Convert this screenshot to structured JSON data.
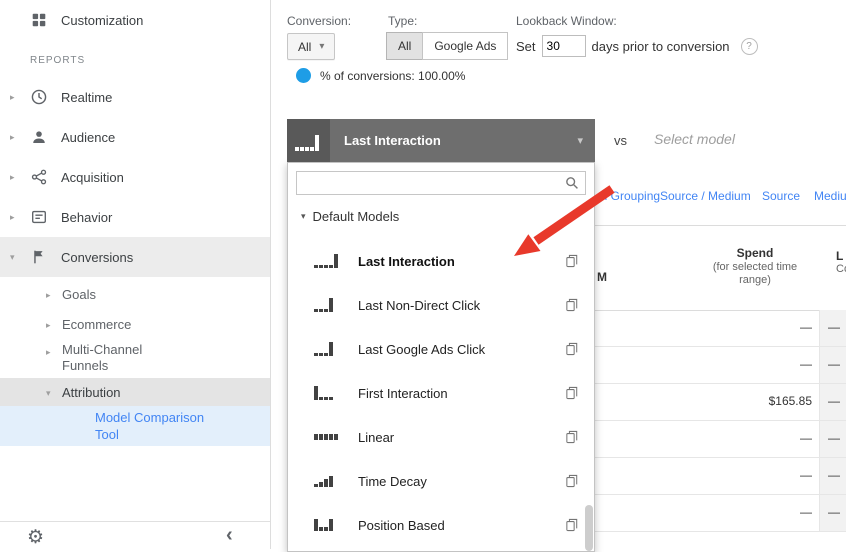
{
  "colors": {
    "accent": "#4285f4",
    "arrow": "#e8392b",
    "dot": "#1e9de6"
  },
  "sidebar": {
    "customization_label": "Customization",
    "reports_label": "REPORTS",
    "nav_items": [
      {
        "label": "Realtime",
        "icon": "clock-icon"
      },
      {
        "label": "Audience",
        "icon": "person-icon"
      },
      {
        "label": "Acquisition",
        "icon": "share-icon"
      },
      {
        "label": "Behavior",
        "icon": "page-icon"
      },
      {
        "label": "Conversions",
        "icon": "flag-icon"
      }
    ],
    "conversions_children": [
      {
        "label": "Goals"
      },
      {
        "label": "Ecommerce"
      },
      {
        "label": "Multi-Channel Funnels"
      },
      {
        "label": "Attribution"
      }
    ],
    "active_item_label": "Model Comparison Tool"
  },
  "toolbar": {
    "conversion_label": "Conversion:",
    "conversion_value": "All",
    "type_label": "Type:",
    "type_all": "All",
    "type_google_ads": "Google Ads",
    "lookback_label": "Lookback Window:",
    "lookback_prefix": "Set",
    "lookback_days": "30",
    "lookback_suffix": "days prior to conversion",
    "percent_of_conversions": "% of conversions: 100.00%"
  },
  "model_bar": {
    "selected_model": "Last Interaction",
    "vs_label": "vs",
    "compare_placeholder": "Select model"
  },
  "dimension_links": {
    "link1": "el Grouping",
    "link2": "Source / Medium",
    "link3": "Source",
    "link4": "Mediu"
  },
  "dropdown": {
    "section_label": "Default Models",
    "header_bars": [
      4,
      4,
      4,
      4,
      16
    ],
    "models": [
      {
        "name": "Last Interaction",
        "bars": [
          3,
          3,
          3,
          3,
          14
        ]
      },
      {
        "name": "Last Non-Direct Click",
        "bars": [
          3,
          3,
          3,
          14
        ]
      },
      {
        "name": "Last Google Ads Click",
        "bars": [
          3,
          3,
          3,
          14
        ]
      },
      {
        "name": "First Interaction",
        "bars": [
          14,
          3,
          3,
          3
        ]
      },
      {
        "name": "Linear",
        "bars": [
          6,
          6,
          6,
          6,
          6
        ]
      },
      {
        "name": "Time Decay",
        "bars": [
          3,
          5,
          8,
          11
        ]
      },
      {
        "name": "Position Based",
        "bars": [
          12,
          4,
          4,
          12
        ]
      }
    ]
  },
  "table": {
    "left_header_fragment": "M",
    "spend_header": "Spend",
    "spend_subheader": "(for selected time range)",
    "right_header_fragment_1": "L",
    "right_header_fragment_2": "Co",
    "rows": [
      {
        "spend": "—",
        "next": "—"
      },
      {
        "spend": "—",
        "next": "—"
      },
      {
        "spend": "$165.85",
        "next": "—"
      },
      {
        "spend": "—",
        "next": "—"
      },
      {
        "spend": "—",
        "next": "—"
      },
      {
        "spend": "—",
        "next": "—"
      }
    ]
  }
}
